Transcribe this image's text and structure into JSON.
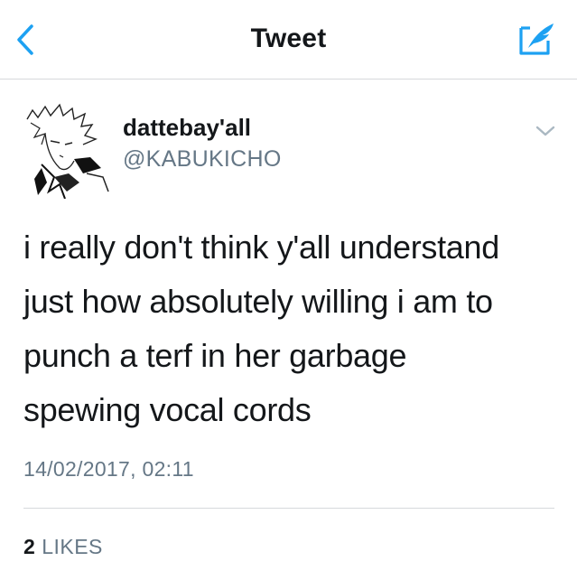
{
  "header": {
    "title": "Tweet",
    "back_icon": "chevron-left-icon",
    "compose_icon": "compose-tweet-icon",
    "accent_color": "#1da1f2"
  },
  "tweet": {
    "author": {
      "display_name": "dattebay'all",
      "handle": "@KABUKICHO",
      "avatar_icon": "avatar-manga-sketch"
    },
    "more_icon": "chevron-down-icon",
    "text_lines": [
      "i really don't think y'all understand",
      "just how absolutely willing i am to",
      "punch a terf in her garbage",
      "spewing vocal cords"
    ],
    "timestamp": "14/02/2017, 02:11",
    "likes": {
      "count": "2",
      "label": "LIKES"
    }
  },
  "colors": {
    "text_primary": "#14171a",
    "text_secondary": "#657786",
    "divider": "#d6d9dc"
  }
}
